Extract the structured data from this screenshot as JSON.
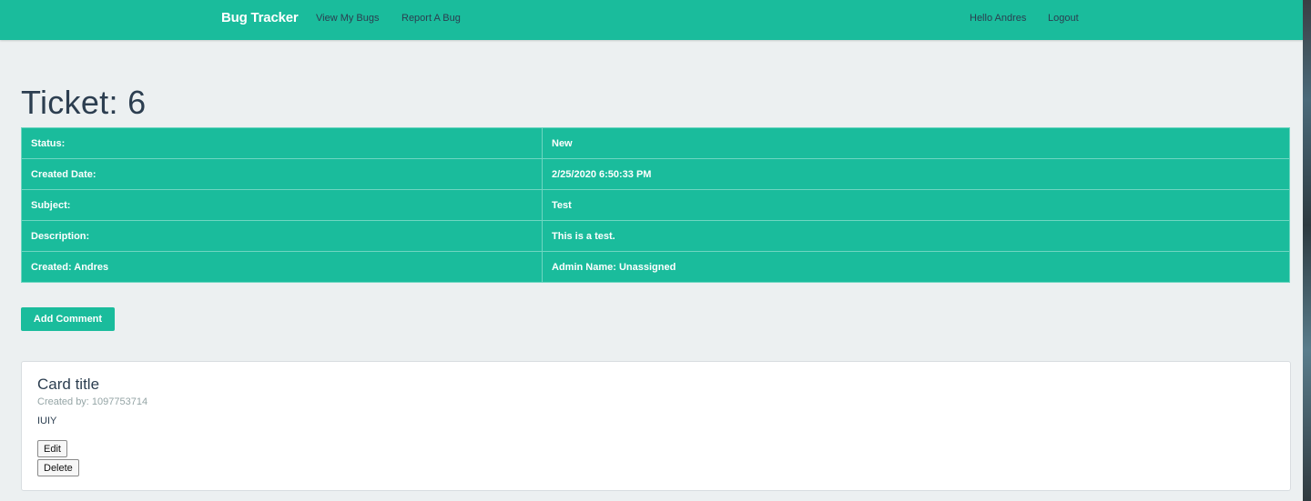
{
  "navbar": {
    "brand": "Bug Tracker",
    "links": [
      "View My Bugs",
      "Report A Bug"
    ],
    "greeting": "Hello Andres",
    "logout": "Logout"
  },
  "page": {
    "title": "Ticket: 6"
  },
  "ticket": {
    "rows": [
      {
        "label": "Status:",
        "value": "New"
      },
      {
        "label": "Created Date:",
        "value": "2/25/2020 6:50:33 PM"
      },
      {
        "label": "Subject:",
        "value": "Test"
      },
      {
        "label": "Description:",
        "value": "This is a test."
      },
      {
        "label": "Created: Andres",
        "value": "Admin Name: Unassigned"
      }
    ]
  },
  "actions": {
    "add_comment": "Add Comment"
  },
  "comment_card": {
    "title": "Card title",
    "subtitle": "Created by: 1097753714",
    "text": "IUIY",
    "edit_label": "Edit",
    "delete_label": "Delete"
  },
  "colors": {
    "accent": "#1abc9c",
    "background": "#ecf0f1",
    "text": "#2c3e50"
  }
}
